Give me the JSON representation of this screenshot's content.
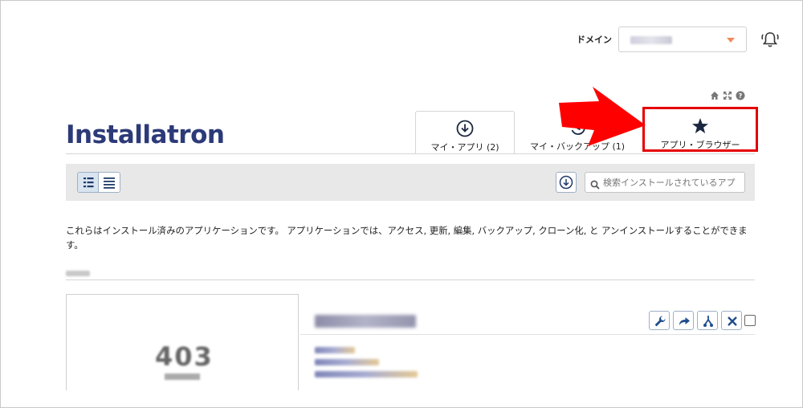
{
  "header": {
    "domain_label": "ドメイン",
    "domain_value": "",
    "bell_icon": "bell-ring-icon"
  },
  "logo": {
    "text": "Installatron",
    "color": "#2d3a78"
  },
  "tabs": [
    {
      "label": "マイ・アプリ (2)",
      "icon": "download-circle-icon",
      "active": true
    },
    {
      "label": "マイ・バックアップ (1)",
      "icon": "history-icon",
      "active": false
    },
    {
      "label": "アプリ・ブラウザー",
      "icon": "star-icon",
      "active": false,
      "highlighted": true
    }
  ],
  "toolbar": {
    "search_placeholder": "検索インストールされているアプ"
  },
  "description": "これらはインストール済みのアプリケーションです。 アプリケーションでは、アクセス, 更新, 編集, バックアップ, クローン化, と アンインストールすることができます。",
  "app_card": {
    "screenshot_code": "403"
  },
  "colors": {
    "accent": "#2d3a78",
    "highlight_border": "#e50000",
    "arrow": "#ff0000",
    "toolbar_bg": "#e8e8e8",
    "button_icon": "#1f4e8c"
  }
}
